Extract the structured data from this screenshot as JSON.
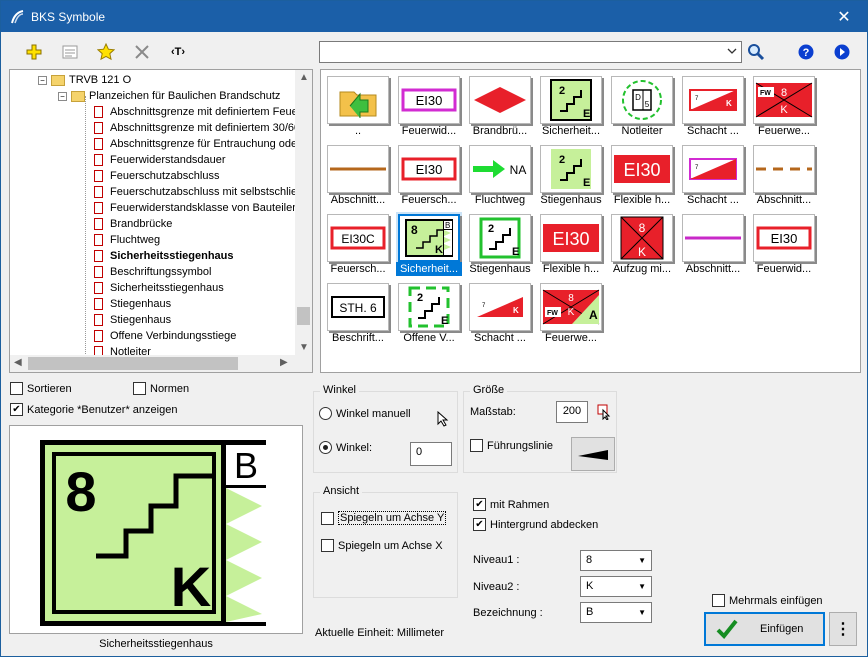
{
  "window": {
    "title": "BKS Symbole",
    "close_glyph": "✕"
  },
  "toolbar": {
    "add_icon": "plus-icon",
    "properties_icon": "properties-icon",
    "favorite_icon": "star-icon",
    "delete_icon": "delete-icon",
    "text_button_label": "‹T›",
    "search_value": "",
    "help_icon": "help-icon",
    "next_icon": "next-icon"
  },
  "tree": {
    "root_label": "TRVB 121 O",
    "group_label": "Planzeichen für Baulichen Brandschutz",
    "items": [
      "Abschnittsgrenze mit definiertem Feue",
      "Abschnittsgrenze mit definiertem 30/60",
      "Abschnittsgrenze für Entrauchung ode",
      "Feuerwiderstandsdauer",
      "Feuerschutzabschluss",
      "Feuerschutzabschluss mit selbstschließ",
      "Feuerwiderstandsklasse von Bauteilen",
      "Brandbrücke",
      "Fluchtweg",
      "Sicherheitsstiegenhaus",
      "Beschriftungssymbol",
      "Sicherheitsstiegenhaus",
      "Stiegenhaus",
      "Stiegenhaus",
      "Offene Verbindungsstiege",
      "Notleiter"
    ],
    "selected_index": 9
  },
  "symbols": [
    {
      "label": "..",
      "kind": "folder-up"
    },
    {
      "label": "Feuerwid...",
      "kind": "ei30-magenta",
      "text": "EI30"
    },
    {
      "label": "Brandbrü...",
      "kind": "red-diamond"
    },
    {
      "label": "Sicherheit...",
      "kind": "stair-2e"
    },
    {
      "label": "Notleiter",
      "kind": "notleiter",
      "text": "D"
    },
    {
      "label": "Schacht ...",
      "kind": "schacht-k",
      "text": "K"
    },
    {
      "label": "Feuerwe...",
      "kind": "fw-8k",
      "text": "FW"
    },
    {
      "label": "Abschnitt...",
      "kind": "line-brown"
    },
    {
      "label": "Feuersch...",
      "kind": "ei30-red",
      "text": "EI30"
    },
    {
      "label": "Fluchtweg",
      "kind": "arrow-na",
      "text": "NA"
    },
    {
      "label": "Stiegenhaus",
      "kind": "stair-2e-plain"
    },
    {
      "label": "Flexible h...",
      "kind": "ei30-filled",
      "text": "EI30"
    },
    {
      "label": "Schacht ...",
      "kind": "schacht-magenta"
    },
    {
      "label": "Abschnitt...",
      "kind": "line-dashed"
    },
    {
      "label": "Feuersch...",
      "kind": "ei30c",
      "text": "EI30C"
    },
    {
      "label": "Sicherheit...",
      "kind": "stair-8k",
      "selected": true
    },
    {
      "label": "Stiegenhaus",
      "kind": "stair-2e-green"
    },
    {
      "label": "Flexible h...",
      "kind": "ei30-filled",
      "text": "EI30"
    },
    {
      "label": "Aufzug mi...",
      "kind": "aufzug",
      "text": "8"
    },
    {
      "label": "Abschnitt...",
      "kind": "line-magenta"
    },
    {
      "label": "Feuerwid...",
      "kind": "ei30-red",
      "text": "EI30"
    },
    {
      "label": "Beschrift...",
      "kind": "sth6",
      "text": "STH. 6"
    },
    {
      "label": "Offene V...",
      "kind": "stair-2e-dashed"
    },
    {
      "label": "Schacht ...",
      "kind": "schacht-k2",
      "text": "K"
    },
    {
      "label": "Feuerwe...",
      "kind": "fw-8ka",
      "text": "FW"
    }
  ],
  "options": {
    "sort_label": "Sortieren",
    "sort_checked": false,
    "norms_label": "Normen",
    "norms_checked": false,
    "category_label": "Kategorie *Benutzer* anzeigen",
    "category_checked": true
  },
  "preview": {
    "caption": "Sicherheitsstiegenhaus",
    "top_number": "8",
    "corner_letter": "B",
    "bottom_letter": "K",
    "fill_color": "#c6f09a"
  },
  "winkel": {
    "title": "Winkel",
    "manual_label": "Winkel manuell",
    "angle_label": "Winkel:",
    "angle_value": "0",
    "mode": "angle"
  },
  "groesse": {
    "title": "Größe",
    "scale_label": "Maßstab:",
    "scale_value": "200",
    "leader_label": "Führungslinie",
    "leader_checked": false
  },
  "ansicht": {
    "title": "Ansicht",
    "mirror_y_label": "Spiegeln um Achse Y",
    "mirror_y_checked": false,
    "mirror_x_label": "Spiegeln um Achse X",
    "mirror_x_checked": false
  },
  "frame": {
    "frame_label": "mit Rahmen",
    "frame_checked": true,
    "background_label": "Hintergrund abdecken",
    "background_checked": true
  },
  "levels": {
    "niveau1_label": "Niveau1 :",
    "niveau1_value": "8",
    "niveau2_label": "Niveau2 :",
    "niveau2_value": "K",
    "bezeichnung_label": "Bezeichnung :",
    "bezeichnung_value": "B"
  },
  "footer": {
    "unit_text": "Aktuelle Einheit: Millimeter",
    "multi_label": "Mehrmals einfügen",
    "multi_checked": false,
    "insert_label": "Einfügen",
    "more_label": "⋮"
  },
  "colors": {
    "title_bar": "#1b5fa8",
    "selection": "#0078d7",
    "symbol_red": "#e8202a",
    "symbol_green": "#c6f09a"
  }
}
